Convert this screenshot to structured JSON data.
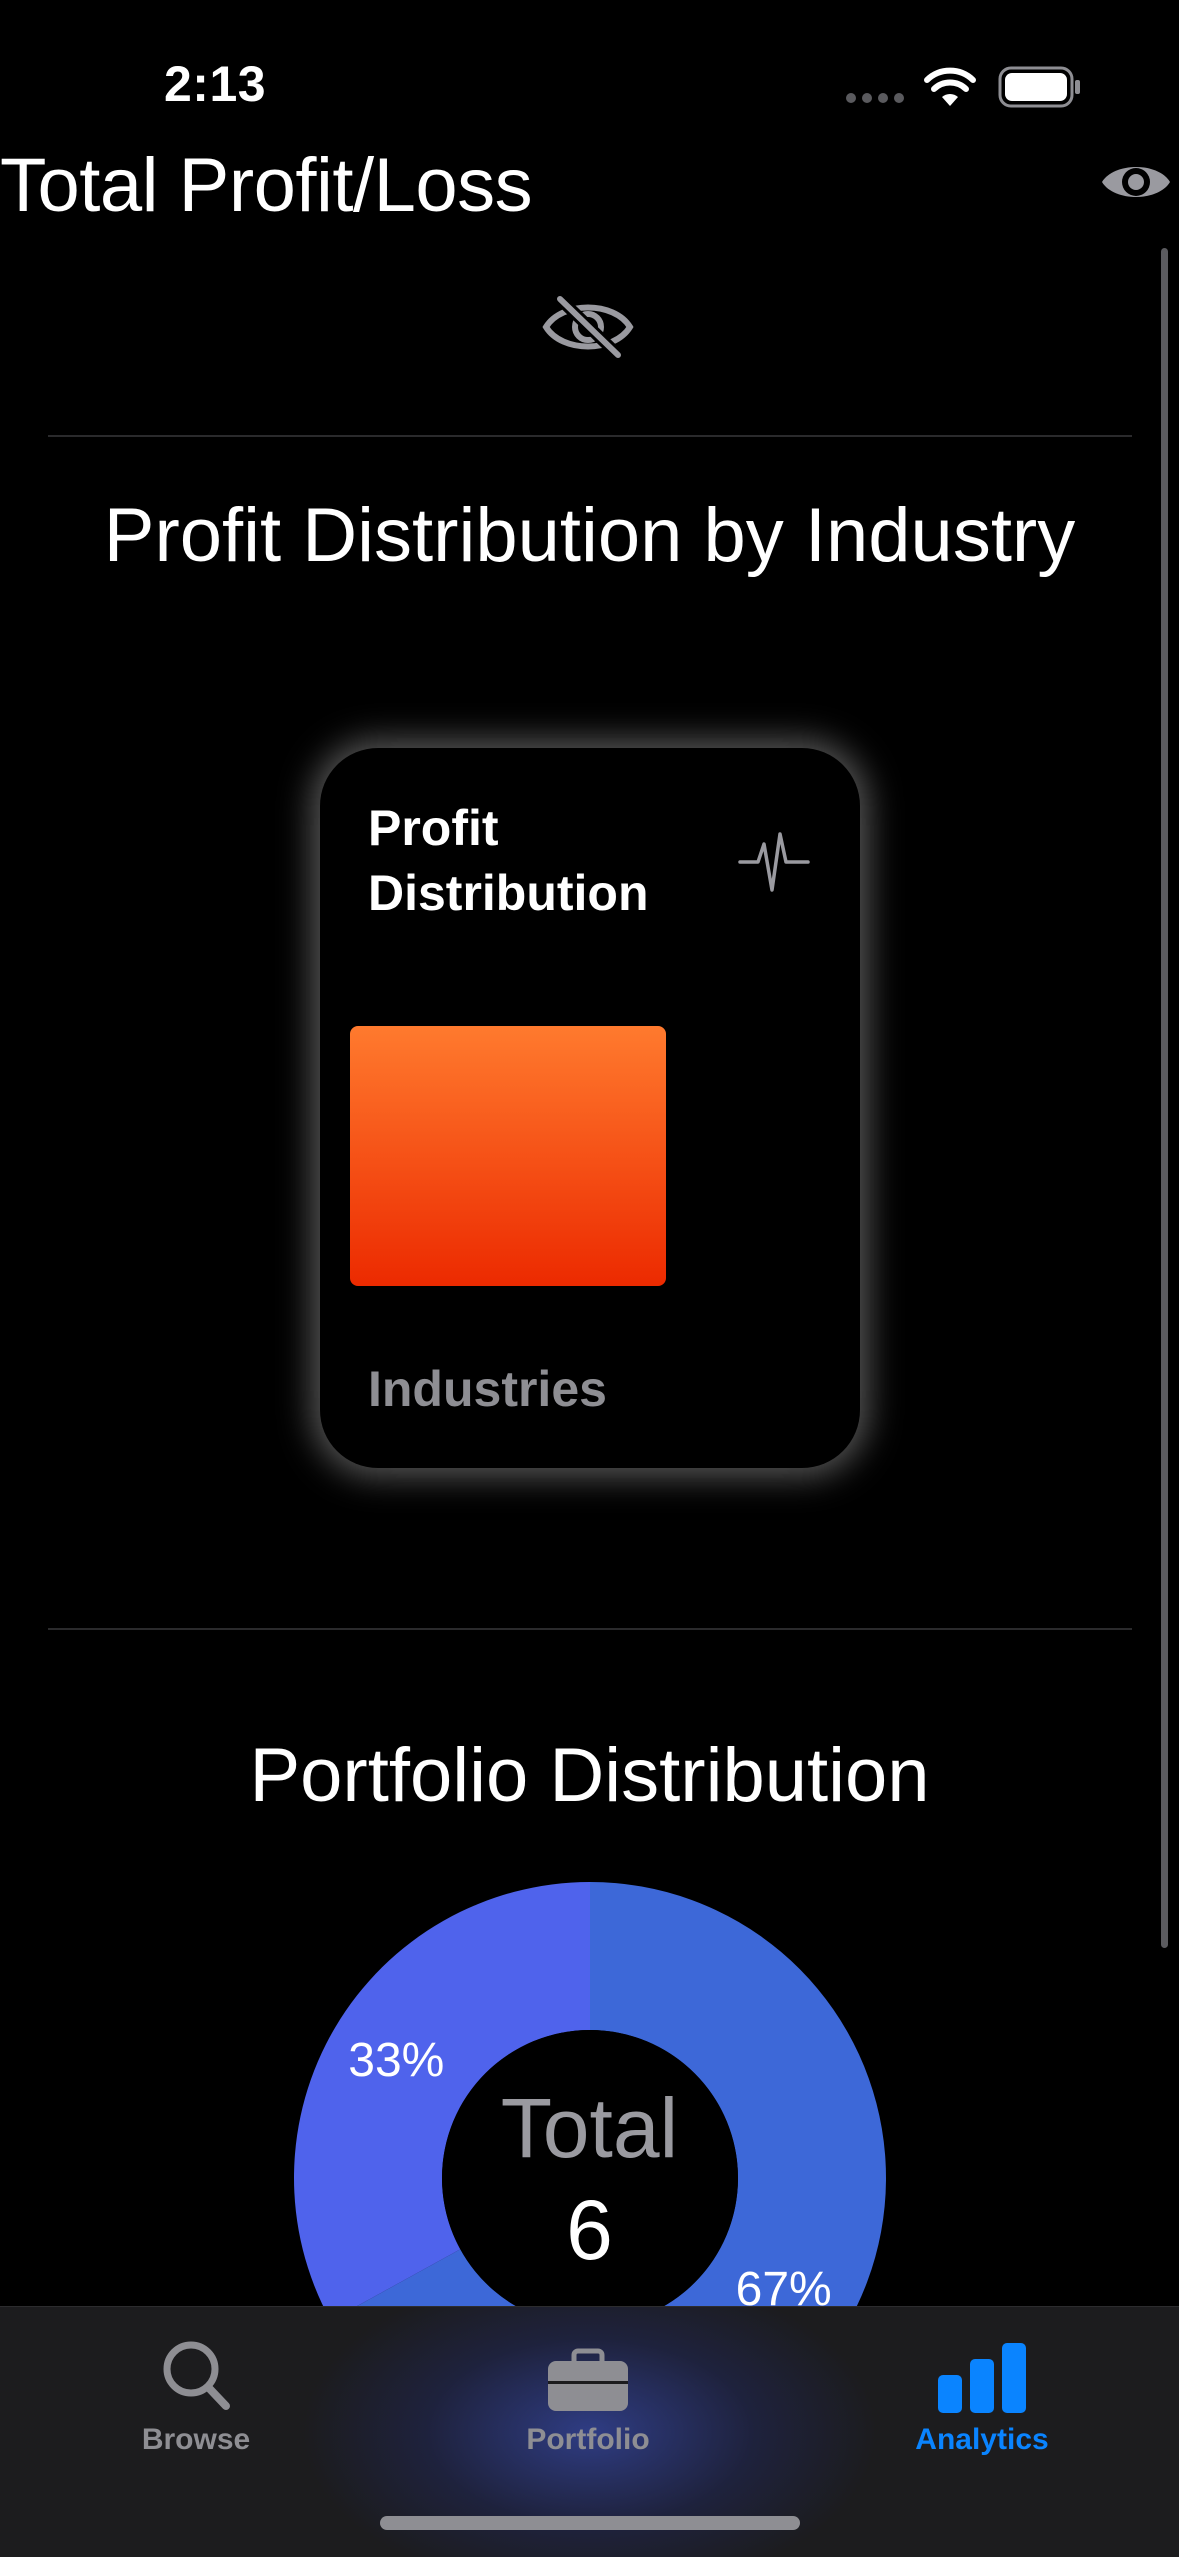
{
  "status_bar": {
    "time": "2:13"
  },
  "header": {
    "title": "Total Profit/Loss",
    "visibility_icon": "eye-icon",
    "hidden_value_icon": "eye-slash-icon"
  },
  "sections": {
    "profit": {
      "title": "Profit Distribution by Industry",
      "card": {
        "title": "Profit Distribution",
        "icon": "waveform-pulse-icon",
        "footer": "Industries"
      }
    },
    "portfolio": {
      "title": "Portfolio Distribution",
      "center_label": "Total",
      "center_value": "6"
    }
  },
  "chart_data": [
    {
      "type": "bar",
      "title": "Profit Distribution",
      "categories": [
        ""
      ],
      "values": [
        1
      ],
      "xlabel": "Industries",
      "colors": [
        "#ff7a2e",
        "#ec2a00"
      ]
    },
    {
      "type": "pie",
      "title": "Portfolio Distribution",
      "slices": [
        {
          "label": "67%",
          "value": 67,
          "color": "#3d68d8"
        },
        {
          "label": "33%",
          "value": 33,
          "color": "#4f63ec"
        }
      ],
      "center_label": "Total",
      "center_value": "6"
    }
  ],
  "tab_bar": {
    "items": [
      {
        "label": "Browse",
        "icon": "magnifying-glass-icon",
        "selected": false
      },
      {
        "label": "Portfolio",
        "icon": "briefcase-icon",
        "selected": false
      },
      {
        "label": "Analytics",
        "icon": "bar-chart-icon",
        "selected": true
      }
    ],
    "active_color": "#0a84ff",
    "inactive_color": "#8e8e93"
  }
}
